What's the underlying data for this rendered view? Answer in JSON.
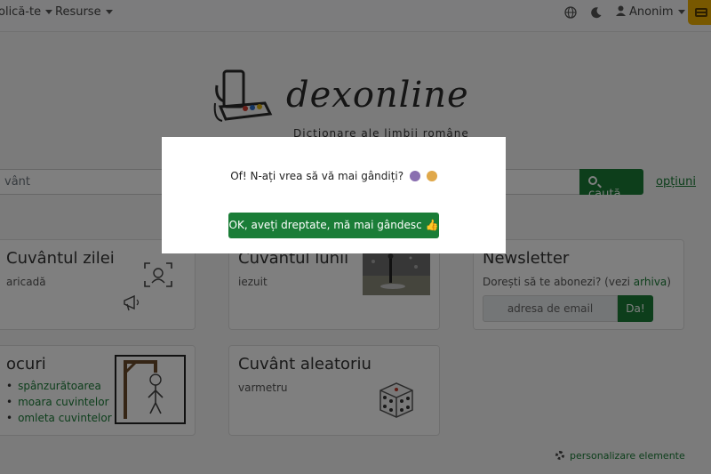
{
  "navbar": {
    "menu_items": [
      {
        "label": "olică-te",
        "icon": "caret-down-icon"
      },
      {
        "label": "Resurse",
        "icon": "caret-down-icon"
      }
    ],
    "language_icon": "globe-icon",
    "theme_icon": "moon-icon",
    "user": {
      "label": "Anonim",
      "icon": "user-icon"
    },
    "account_icon": "credit-card-icon"
  },
  "logo": {
    "text": "dexonline",
    "subtitle": "Dicționare ale limbii române"
  },
  "search": {
    "value": "vânt",
    "button_label": "caută",
    "options_label": "opțiuni"
  },
  "cards": {
    "word_of_day": {
      "title": "Cuvântul zilei",
      "word": "aricadă"
    },
    "word_of_month": {
      "title": "Cuvântul lunii",
      "word": "iezuit"
    },
    "newsletter": {
      "title": "Newsletter",
      "text_before": "Dorești să te abonezi? (vezi ",
      "archive_link": "arhiva",
      "text_after": ")",
      "email_placeholder": "adresa de email",
      "submit_label": "Da!"
    },
    "games": {
      "title": "ocuri",
      "items": [
        "spânzurătoarea",
        "moara cuvintelor",
        "omleta cuvintelor"
      ]
    },
    "random_word": {
      "title": "Cuvânt aleatoriu",
      "word": "varmetru"
    }
  },
  "personalize_label": "personalizare elemente",
  "modal": {
    "message": "Of! N-ați vrea să vă mai gândiți?",
    "button_label": "OK, aveți dreptate, mă mai gândesc 👍"
  }
}
